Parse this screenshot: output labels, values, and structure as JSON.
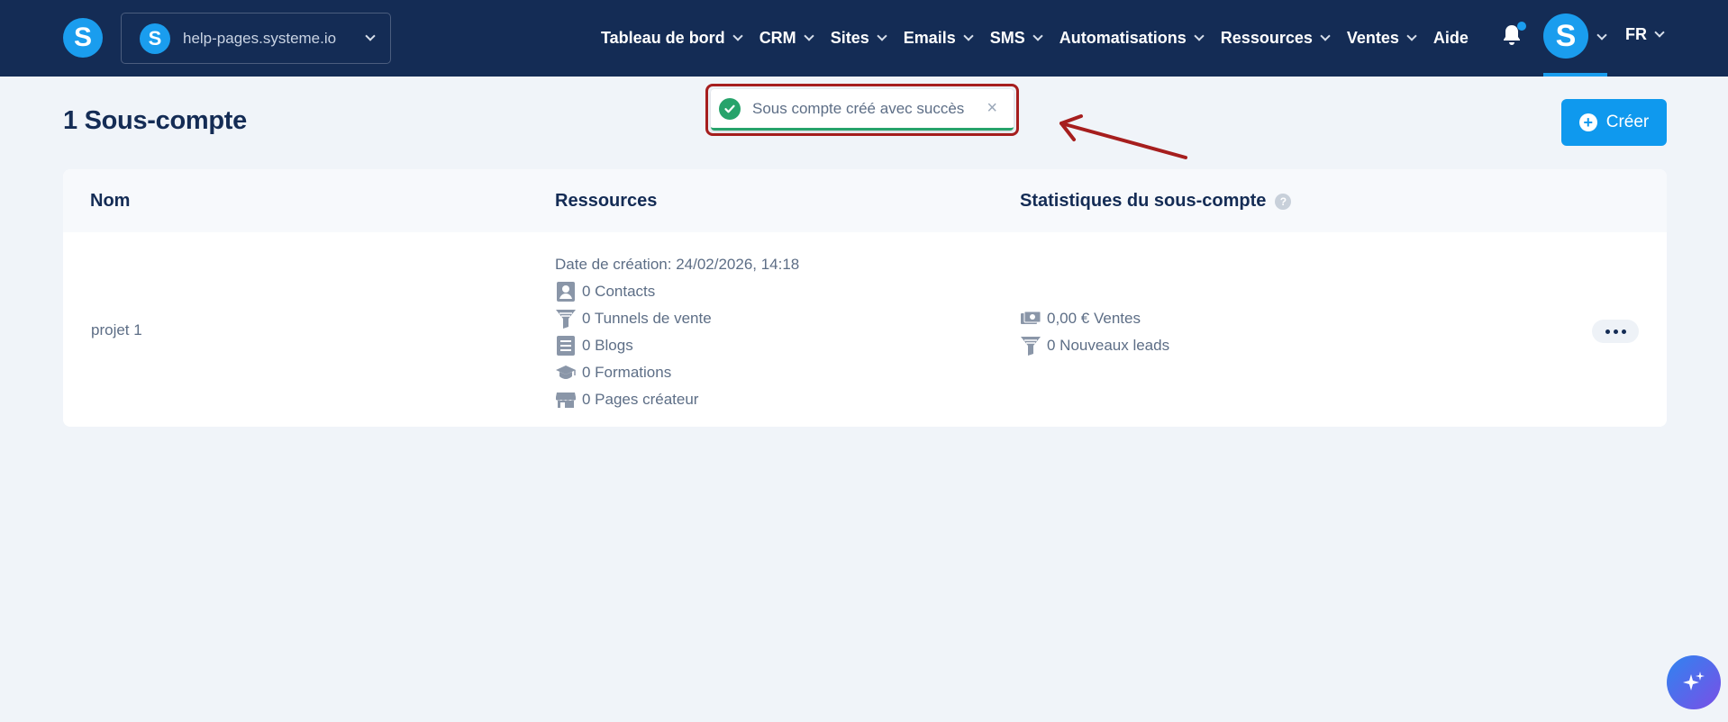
{
  "header": {
    "logo_letter": "S",
    "site": {
      "letter": "S",
      "name": "help-pages.systeme.io"
    },
    "nav": [
      {
        "label": "Tableau de bord",
        "dropdown": true
      },
      {
        "label": "CRM",
        "dropdown": true
      },
      {
        "label": "Sites",
        "dropdown": true
      },
      {
        "label": "Emails",
        "dropdown": true
      },
      {
        "label": "SMS",
        "dropdown": true
      },
      {
        "label": "Automatisations",
        "dropdown": true
      },
      {
        "label": "Ressources",
        "dropdown": true
      },
      {
        "label": "Ventes",
        "dropdown": true
      },
      {
        "label": "Aide",
        "dropdown": false
      }
    ],
    "avatar_letter": "S",
    "language": "FR"
  },
  "page": {
    "title": "1 Sous-compte",
    "create_label": "Créer"
  },
  "toast": {
    "message": "Sous compte créé avec succès",
    "close_glyph": "×"
  },
  "table": {
    "headers": {
      "name": "Nom",
      "resources": "Ressources",
      "stats": "Statistiques du sous-compte",
      "help_glyph": "?"
    },
    "rows": [
      {
        "name": "projet 1",
        "created": "Date de création: 24/02/2026, 14:18",
        "resources": [
          {
            "icon": "contact-icon",
            "text": "0 Contacts"
          },
          {
            "icon": "funnel-icon",
            "text": "0 Tunnels de vente"
          },
          {
            "icon": "blog-icon",
            "text": "0 Blogs"
          },
          {
            "icon": "graduation-cap-icon",
            "text": "0 Formations"
          },
          {
            "icon": "storefront-icon",
            "text": "0 Pages créateur"
          }
        ],
        "stats": [
          {
            "icon": "money-icon",
            "text": "0,00 € Ventes"
          },
          {
            "icon": "funnel-icon",
            "text": "0 Nouveaux leads"
          }
        ]
      }
    ]
  },
  "colors": {
    "header_bg": "#142c55",
    "brand_blue": "#1a9dee",
    "success_green": "#27a36b",
    "annotation_red": "#a61e1e",
    "page_bg": "#f0f4f9"
  }
}
